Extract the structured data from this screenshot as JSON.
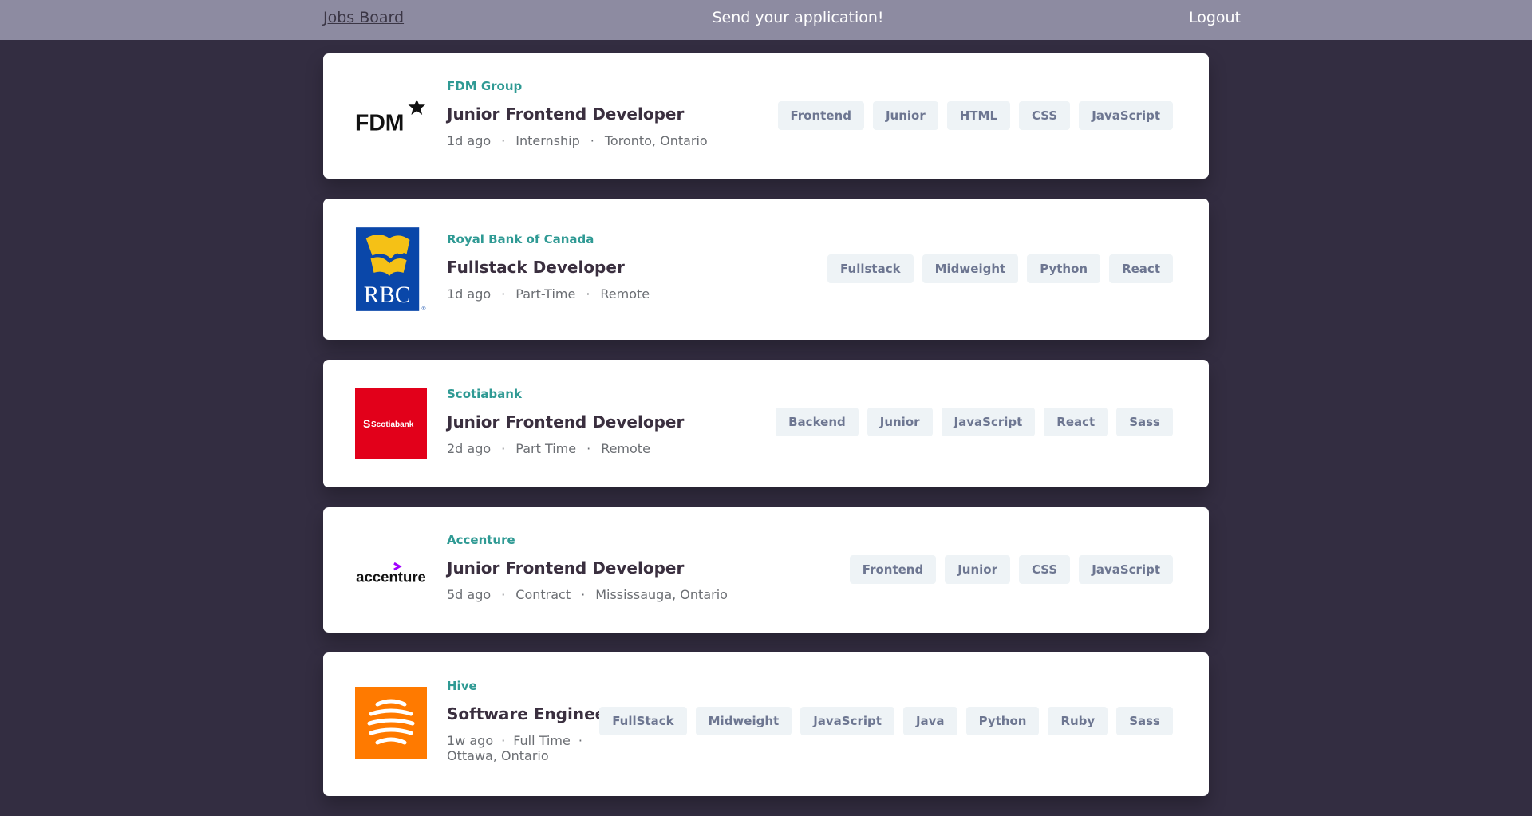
{
  "header": {
    "brand": "Jobs Board",
    "tagline": "Send your application!",
    "logout": "Logout"
  },
  "colors": {
    "header_bg": "#8d8ba1",
    "page_bg": "#332d41",
    "company_text": "#2f9a94",
    "tag_bg": "#eef3f6"
  },
  "jobs": [
    {
      "company": "FDM Group",
      "logo": "fdm-logo",
      "logo_text": "FDM",
      "position": "Junior Frontend Developer",
      "posted": "1d ago",
      "contract": "Internship",
      "location": "Toronto, Ontario",
      "tags": [
        "Frontend",
        "Junior",
        "HTML",
        "CSS",
        "JavaScript"
      ]
    },
    {
      "company": "Royal Bank of Canada",
      "logo": "rbc-logo",
      "logo_text": "RBC",
      "position": "Fullstack Developer",
      "posted": "1d ago",
      "contract": "Part-Time",
      "location": "Remote",
      "tags": [
        "Fullstack",
        "Midweight",
        "Python",
        "React"
      ]
    },
    {
      "company": "Scotiabank",
      "logo": "scotiabank-logo",
      "logo_text": "Scotiabank",
      "position": "Junior Frontend Developer",
      "posted": "2d ago",
      "contract": "Part Time",
      "location": "Remote",
      "tags": [
        "Backend",
        "Junior",
        "JavaScript",
        "React",
        "Sass"
      ]
    },
    {
      "company": "Accenture",
      "logo": "accenture-logo",
      "logo_text": "accenture",
      "position": "Junior Frontend Developer",
      "posted": "5d ago",
      "contract": "Contract",
      "location": "Mississauga, Ontario",
      "tags": [
        "Frontend",
        "Junior",
        "CSS",
        "JavaScript"
      ]
    },
    {
      "company": "Hive",
      "logo": "hive-logo",
      "logo_text": "",
      "position": "Software Engineer",
      "posted": "1w ago",
      "contract": "Full Time",
      "location": "Ottawa, Ontario",
      "tags": [
        "FullStack",
        "Midweight",
        "JavaScript",
        "Java",
        "Python",
        "Ruby",
        "Sass"
      ]
    }
  ]
}
